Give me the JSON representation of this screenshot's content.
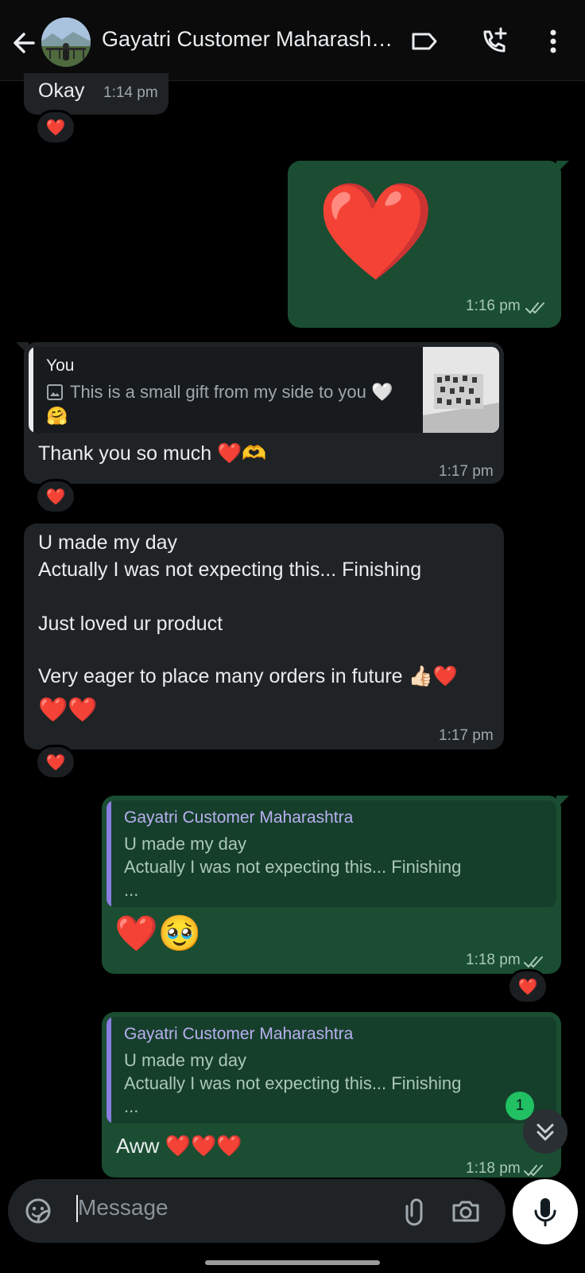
{
  "header": {
    "contact_name": "Gayatri Customer Maharasht…"
  },
  "messages": {
    "m1": {
      "text": "Okay",
      "time": "1:14 pm",
      "reaction": "❤️"
    },
    "m2": {
      "emoji": "❤️",
      "time": "1:16 pm"
    },
    "m3": {
      "quote_name": "You",
      "quote_text": "This is a small gift from my side to you 🤍",
      "quote_text2": "🤗",
      "text": "Thank you so much ❤️🫶",
      "time": "1:17 pm",
      "reaction": "❤️"
    },
    "m4": {
      "line1": "U made my day",
      "line2": "Actually I was not expecting this... Finishing",
      "line3": "Just loved ur product",
      "line4": "Very eager to place many orders in future 👍🏻❤️",
      "line5": "❤️❤️",
      "time": "1:17 pm",
      "reaction": "❤️"
    },
    "m5": {
      "quote_name": "Gayatri Customer Maharashtra",
      "quote_text": "U made my day\nActually I was not expecting this... Finishing\n...",
      "text": "❤️🥹",
      "time": "1:18 pm",
      "reaction": "❤️"
    },
    "m6": {
      "quote_name": "Gayatri Customer Maharashtra",
      "quote_text": "U made my day\nActually I was not expecting this... Finishing\n...",
      "text": "Aww ❤️❤️❤️",
      "time": "1:18 pm"
    }
  },
  "scroll": {
    "unread_count": "1"
  },
  "composer": {
    "placeholder": "Message"
  },
  "colors": {
    "background": "#000000",
    "incoming_bubble": "#1f2326",
    "outgoing_bubble": "#1a4d32",
    "quote_bar_purple": "#8a7ee0",
    "unread_badge": "#21c063"
  }
}
